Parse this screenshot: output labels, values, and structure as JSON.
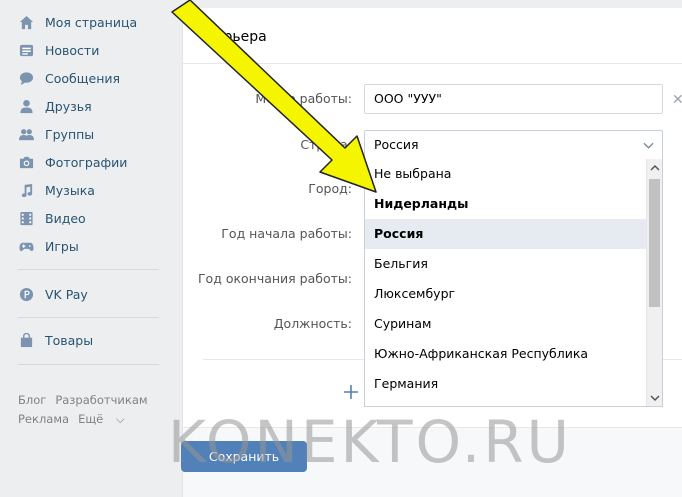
{
  "sidebar": {
    "items": [
      {
        "label": "Моя страница",
        "icon": "home-icon"
      },
      {
        "label": "Новости",
        "icon": "news-icon"
      },
      {
        "label": "Сообщения",
        "icon": "messages-icon"
      },
      {
        "label": "Друзья",
        "icon": "friend-icon"
      },
      {
        "label": "Группы",
        "icon": "groups-icon"
      },
      {
        "label": "Фотографии",
        "icon": "camera-icon"
      },
      {
        "label": "Музыка",
        "icon": "music-icon"
      },
      {
        "label": "Видео",
        "icon": "video-icon"
      },
      {
        "label": "Игры",
        "icon": "gamepad-icon"
      }
    ],
    "vkpay": {
      "label": "VK Pay",
      "icon": "vkpay-icon"
    },
    "goods": {
      "label": "Товары",
      "icon": "bag-icon"
    },
    "footer": {
      "blog": "Блог",
      "dev": "Разработчикам",
      "ads": "Реклама",
      "more": "Ещё"
    }
  },
  "card": {
    "title": "Карьера",
    "labels": {
      "workplace": "Место работы:",
      "country": "Страна:",
      "city": "Город:",
      "start_year": "Год начала работы:",
      "end_year": "Год окончания работы:",
      "position": "Должность:"
    },
    "workplace_value": "ООО \"УУУ\"",
    "country_value": "Россия",
    "dropdown": [
      {
        "label": "Не выбрана"
      },
      {
        "label": "Нидерланды"
      },
      {
        "label": "Россия"
      },
      {
        "label": "Бельгия"
      },
      {
        "label": "Люксембург"
      },
      {
        "label": "Суринам"
      },
      {
        "label": "Южно-Африканская Республика"
      },
      {
        "label": "Германия"
      }
    ],
    "save_label": "Сохранить"
  },
  "watermark": "KONEKTO.RU",
  "colors": {
    "accent": "#5181b8",
    "link": "#285473",
    "arrow": "#f5f500"
  }
}
